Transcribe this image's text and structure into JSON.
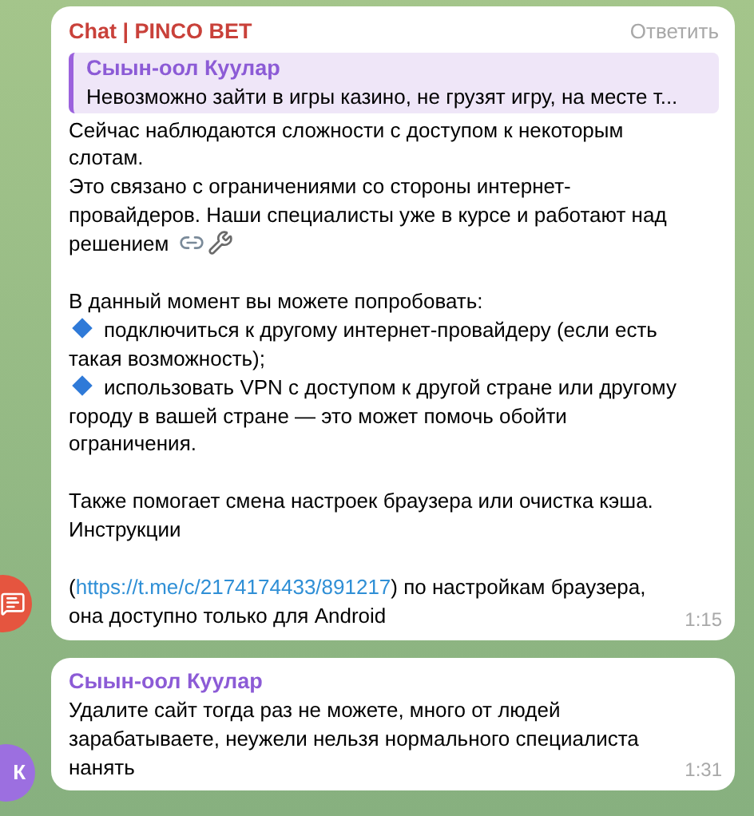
{
  "messages": [
    {
      "sender": "Chat | PINCO BET",
      "color": "#c9413a",
      "reply_action": "Ответить",
      "quote": {
        "author": "Сыын-оол Куулар",
        "text": "Невозможно зайти в игры казино, не грузят игру, на месте т..."
      },
      "body": [
        {
          "kind": "text",
          "text": "Сейчас наблюдаются сложности с доступом к некоторым слотам."
        },
        {
          "kind": "text",
          "text": "Это связано с ограничениями со стороны интернет-провайдеров. Наши специалисты уже в курсе и работают над"
        },
        {
          "kind": "text_tools",
          "text": "решением"
        },
        {
          "kind": "gap"
        },
        {
          "kind": "text",
          "text": "В данный момент вы можете попробовать:"
        },
        {
          "kind": "bullet",
          "text": "подключиться к другому интернет-провайдеру (если есть такая возможность);"
        },
        {
          "kind": "bullet",
          "text": "использовать VPN с доступом к другой стране или другому городу в вашей стране — это может помочь обойти ограничения."
        },
        {
          "kind": "gap"
        },
        {
          "kind": "text",
          "text": "Также помогает смена настроек браузера или очистка кэша."
        },
        {
          "kind": "text",
          "text": "Инструкции"
        },
        {
          "kind": "gap"
        },
        {
          "kind": "link",
          "before": "(",
          "link": "https://t.me/c/2174174433/891217",
          "after": ") по настройкам браузера, она доступно только для Android"
        }
      ],
      "time": "1:15",
      "avatar": {
        "kind": "icon",
        "color": "#e5553f"
      }
    },
    {
      "sender": "Сыын-оол Куулар",
      "color": "#8c5bd6",
      "body": [
        {
          "kind": "text",
          "text": "Удалите сайт тогда раз не можете, много от людей зарабатываете, неужели нельзя нормального специалиста нанять"
        }
      ],
      "time": "1:31",
      "avatar": {
        "kind": "initials",
        "label": "К",
        "color": "#9c6fe0"
      }
    }
  ]
}
